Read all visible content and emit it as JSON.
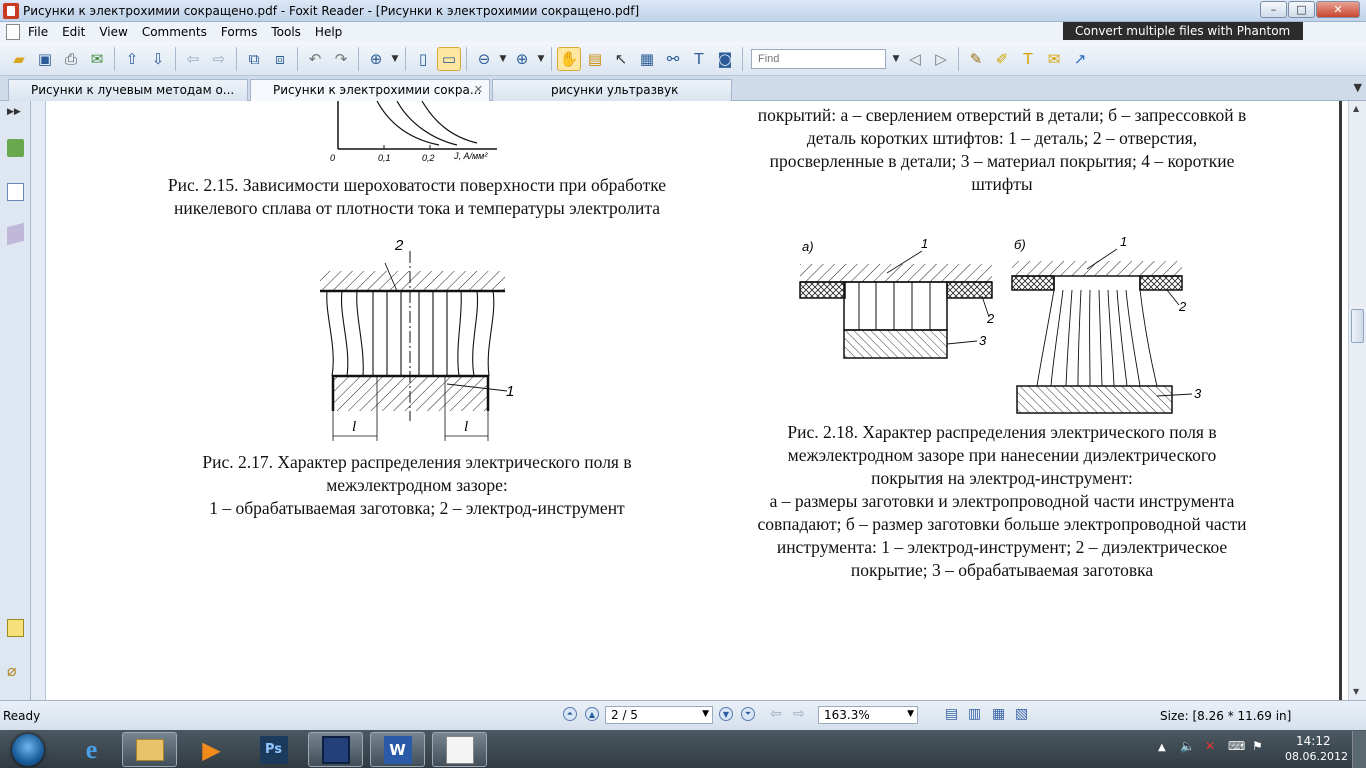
{
  "window": {
    "title": "Рисунки к электрохимии сокращено.pdf - Foxit Reader - [Рисунки к электрохимии сокращено.pdf]",
    "controls": {
      "minimize": "–",
      "maximize": "□",
      "close": "✕"
    }
  },
  "menu": [
    "File",
    "Edit",
    "View",
    "Comments",
    "Forms",
    "Tools",
    "Help"
  ],
  "banner": {
    "text": "Convert multiple files with Phantom"
  },
  "toolbar": {
    "find_placeholder": "Find"
  },
  "tabs": [
    {
      "label": "Рисунки к лучевым методам о..."
    },
    {
      "label": "Рисунки к электрохимии сокра..."
    },
    {
      "label": "рисунки ультразвук"
    }
  ],
  "document": {
    "fig215_axis": {
      "x0": "0",
      "x1": "0,1",
      "x2": "0,2",
      "xlabel": "J, А/мм²"
    },
    "fig215_caption": [
      "Рис. 2.15. Зависимости шероховатости поверхности при обработке",
      "никелевого сплава от плотности тока и температуры электролита"
    ],
    "top_right_caption": [
      "покрытий: а – сверлением отверстий в детали; б – запрессовкой в",
      "деталь коротких штифтов: 1 – деталь; 2 – отверстия,",
      "просверленные в детали;  3 – материал покрытия; 4 – короткие",
      "штифты"
    ],
    "fig217_labels": {
      "n1": "1",
      "n2": "2",
      "l1": "l",
      "l2": "l"
    },
    "fig217_caption": [
      "Рис. 2.17. Характер распределения электрического поля в",
      "межэлектродном зазоре:",
      "1 – обрабатываемая заготовка; 2 – электрод-инструмент"
    ],
    "fig218_labels": {
      "a": "а)",
      "b": "б)",
      "a1": "1",
      "a2": "2",
      "a3": "3",
      "b1": "1",
      "b2": "2",
      "b3": "3"
    },
    "fig218_caption": [
      "Рис. 2.18. Характер распределения электрического поля в",
      "межэлектродном зазоре при нанесении диэлектрического",
      "покрытия на электрод-инструмент:",
      "а – размеры заготовки и электропроводной части инструмента",
      "совпадают; б – размер заготовки больше электропроводной части",
      "инструмента: 1 – электрод-инструмент; 2 – диэлектрическое",
      "покрытие; 3 – обрабатываемая заготовка"
    ]
  },
  "status": {
    "ready": "Ready",
    "page": "2 / 5",
    "zoom": "163.3%",
    "size": "Size: [8.26 * 11.69 in]"
  },
  "taskbar": {
    "time": "14:12",
    "date": "08.06.2012",
    "apps": [
      "ie-icon",
      "explorer-icon",
      "media-player-icon",
      "photoshop-icon",
      "floppy-icon",
      "word-icon",
      "foxit-icon"
    ]
  }
}
